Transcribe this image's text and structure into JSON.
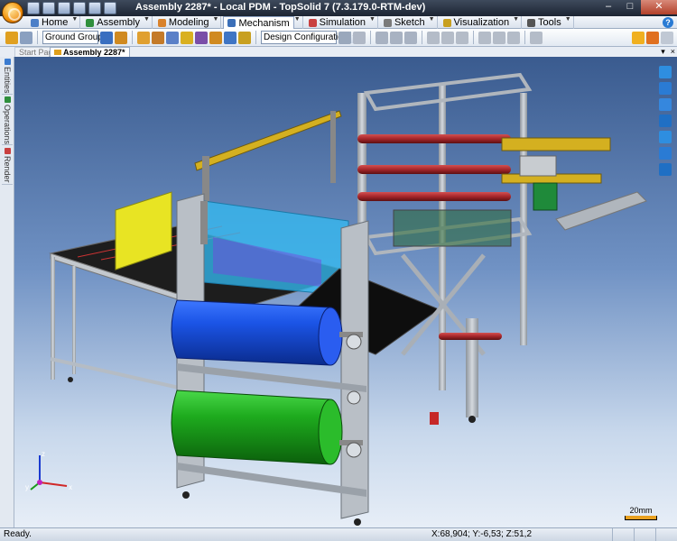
{
  "window": {
    "title": "Assembly 2287* - Local PDM - TopSolid 7 (7.3.179.0-RTM-dev)"
  },
  "window_controls": {
    "minimize": "–",
    "maximize": "□",
    "close": "✕"
  },
  "ribbon": {
    "tabs": [
      {
        "label": "Home",
        "icon": "home-icon",
        "color": "#4c7fc8"
      },
      {
        "label": "Assembly",
        "icon": "assembly-icon",
        "color": "#2f8f3c"
      },
      {
        "label": "Modeling",
        "icon": "modeling-icon",
        "color": "#d9822b"
      },
      {
        "label": "Mechanism",
        "icon": "mechanism-icon",
        "color": "#3b6fb8",
        "active": true
      },
      {
        "label": "Simulation",
        "icon": "simulation-icon",
        "color": "#c94040"
      },
      {
        "label": "Sketch",
        "icon": "sketch-icon",
        "color": "#7a7a7a"
      },
      {
        "label": "Visualization",
        "icon": "visualization-icon",
        "color": "#c8a020"
      },
      {
        "label": "Tools",
        "icon": "tools-icon",
        "color": "#555555"
      }
    ],
    "help": "?"
  },
  "toolbar": {
    "ground_group": "Ground Group",
    "design_configuration": "Design Configuration"
  },
  "doc_tabs": {
    "start_page": "Start Page",
    "active": "Assembly 2287*",
    "pin": "▾",
    "close": "×"
  },
  "side_dock": {
    "tabs": [
      "Entities",
      "Operations",
      "Render"
    ]
  },
  "viewport": {
    "scale_label": "20mm",
    "axis_x": "x",
    "axis_y": "y",
    "axis_z": "z"
  },
  "status": {
    "text": "Ready.",
    "coordinates": "X:68,904; Y:-6,53; Z:51,2"
  },
  "colors": {
    "accent": "#3b6fb8",
    "viewport_top": "#3a5b8f",
    "viewport_bottom": "#e7eef7",
    "roller_blue": "#1f4fd9",
    "roller_green": "#1ea81e",
    "frame_grey": "#b9bfc6",
    "frame_red": "#a5262a",
    "yellow_panel": "#e8e423",
    "cyan_film": "#33b9f0"
  }
}
